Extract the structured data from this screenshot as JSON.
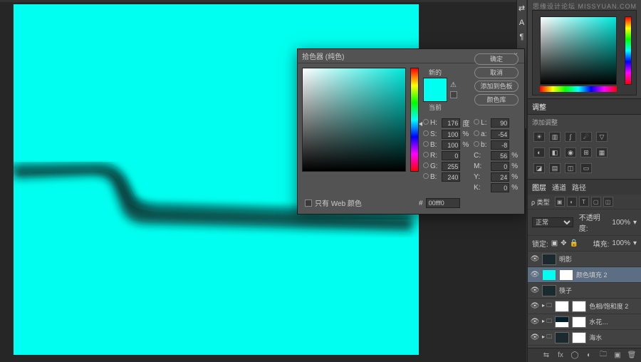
{
  "watermark": "思缘设计论坛  MISSYUAN.COM",
  "dialog": {
    "title": "拾色器 (纯色)",
    "close": "×",
    "ok": "确定",
    "cancel": "取消",
    "add_swatch": "添加到色板",
    "color_lib": "颜色库",
    "new_label": "新的",
    "current_label": "当前",
    "web_only": "只有 Web 颜色",
    "hex_prefix": "#",
    "hex": "00fff0",
    "H": {
      "l": "H:",
      "v": "176",
      "u": "度"
    },
    "S": {
      "l": "S:",
      "v": "100",
      "u": "%"
    },
    "Bv": {
      "l": "B:",
      "v": "100",
      "u": "%"
    },
    "R": {
      "l": "R:",
      "v": "0"
    },
    "G": {
      "l": "G:",
      "v": "255"
    },
    "B2": {
      "l": "B:",
      "v": "240"
    },
    "L": {
      "l": "L:",
      "v": "90"
    },
    "a": {
      "l": "a:",
      "v": "-54"
    },
    "b": {
      "l": "b:",
      "v": "-8"
    },
    "C": {
      "l": "C:",
      "v": "56",
      "u": "%"
    },
    "M": {
      "l": "M:",
      "v": "0",
      "u": "%"
    },
    "Y": {
      "l": "Y:",
      "v": "24",
      "u": "%"
    },
    "K": {
      "l": "K:",
      "v": "0",
      "u": "%"
    }
  },
  "panels": {
    "adjust_tab": "调整",
    "adjust_hint": "添加调整",
    "tabs": {
      "layers": "图层",
      "channels": "通道",
      "paths": "路径"
    },
    "filter_label": "ρ 类型",
    "blend": "正常",
    "opacity_label": "不透明度:",
    "opacity": "100%",
    "lock_label": "锁定:",
    "fill_label": "填充:",
    "fill": "100%"
  },
  "layers": [
    {
      "name": "明影",
      "thumb": "dark",
      "mask": false,
      "sel": false
    },
    {
      "name": "颜色填充 2",
      "thumb": "cyan",
      "mask": true,
      "sel": true
    },
    {
      "name": "筷子",
      "thumb": "dark",
      "mask": false,
      "sel": false
    },
    {
      "name": "色相/饱和度 2",
      "thumb": "white",
      "mask": true,
      "sel": false,
      "pre": "▸ 🗀"
    },
    {
      "name": "水花…",
      "thumb": "img",
      "mask": true,
      "sel": false,
      "pre": "▸ 🗀"
    },
    {
      "name": "海水",
      "thumb": "dark",
      "mask": true,
      "sel": false,
      "pre": "▸ 🗀"
    }
  ]
}
